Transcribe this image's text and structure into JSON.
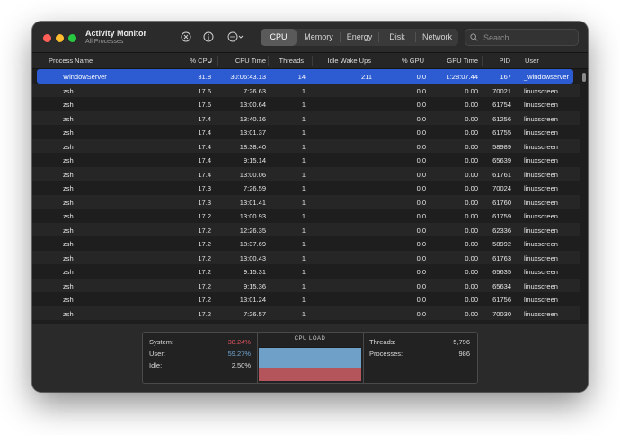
{
  "app": {
    "title": "Activity Monitor",
    "subtitle": "All Processes"
  },
  "toolbar": {
    "tabs": [
      {
        "label": "CPU",
        "active": true
      },
      {
        "label": "Memory",
        "active": false
      },
      {
        "label": "Energy",
        "active": false
      },
      {
        "label": "Disk",
        "active": false
      },
      {
        "label": "Network",
        "active": false
      }
    ],
    "search_placeholder": "Search"
  },
  "table": {
    "headers": {
      "name": "Process Name",
      "cpu": "% CPU",
      "cpu_time": "CPU Time",
      "threads": "Threads",
      "idle_wakeups": "Idle Wake Ups",
      "gpu": "% GPU",
      "gpu_time": "GPU Time",
      "pid": "PID",
      "user": "User"
    },
    "sort_indicator": "⌄",
    "rows": [
      {
        "name": "WindowServer",
        "cpu": "31.8",
        "cpu_time": "30:06:43.13",
        "threads": "14",
        "idle_wakeups": "211",
        "gpu": "0.0",
        "gpu_time": "1:28:07.44",
        "pid": "167",
        "user": "_windowserver",
        "selected": true
      },
      {
        "name": "zsh",
        "cpu": "17.6",
        "cpu_time": "7:26.63",
        "threads": "1",
        "idle_wakeups": "",
        "gpu": "0.0",
        "gpu_time": "0.00",
        "pid": "70021",
        "user": "linuxscreen"
      },
      {
        "name": "zsh",
        "cpu": "17.6",
        "cpu_time": "13:00.64",
        "threads": "1",
        "idle_wakeups": "",
        "gpu": "0.0",
        "gpu_time": "0.00",
        "pid": "61754",
        "user": "linuxscreen"
      },
      {
        "name": "zsh",
        "cpu": "17.4",
        "cpu_time": "13:40.16",
        "threads": "1",
        "idle_wakeups": "",
        "gpu": "0.0",
        "gpu_time": "0.00",
        "pid": "61256",
        "user": "linuxscreen"
      },
      {
        "name": "zsh",
        "cpu": "17.4",
        "cpu_time": "13:01.37",
        "threads": "1",
        "idle_wakeups": "",
        "gpu": "0.0",
        "gpu_time": "0.00",
        "pid": "61755",
        "user": "linuxscreen"
      },
      {
        "name": "zsh",
        "cpu": "17.4",
        "cpu_time": "18:38.40",
        "threads": "1",
        "idle_wakeups": "",
        "gpu": "0.0",
        "gpu_time": "0.00",
        "pid": "58989",
        "user": "linuxscreen"
      },
      {
        "name": "zsh",
        "cpu": "17.4",
        "cpu_time": "9:15.14",
        "threads": "1",
        "idle_wakeups": "",
        "gpu": "0.0",
        "gpu_time": "0.00",
        "pid": "65639",
        "user": "linuxscreen"
      },
      {
        "name": "zsh",
        "cpu": "17.4",
        "cpu_time": "13:00.06",
        "threads": "1",
        "idle_wakeups": "",
        "gpu": "0.0",
        "gpu_time": "0.00",
        "pid": "61761",
        "user": "linuxscreen"
      },
      {
        "name": "zsh",
        "cpu": "17.3",
        "cpu_time": "7:26.59",
        "threads": "1",
        "idle_wakeups": "",
        "gpu": "0.0",
        "gpu_time": "0.00",
        "pid": "70024",
        "user": "linuxscreen"
      },
      {
        "name": "zsh",
        "cpu": "17.3",
        "cpu_time": "13:01.41",
        "threads": "1",
        "idle_wakeups": "",
        "gpu": "0.0",
        "gpu_time": "0.00",
        "pid": "61760",
        "user": "linuxscreen"
      },
      {
        "name": "zsh",
        "cpu": "17.2",
        "cpu_time": "13:00.93",
        "threads": "1",
        "idle_wakeups": "",
        "gpu": "0.0",
        "gpu_time": "0.00",
        "pid": "61759",
        "user": "linuxscreen"
      },
      {
        "name": "zsh",
        "cpu": "17.2",
        "cpu_time": "12:26.35",
        "threads": "1",
        "idle_wakeups": "",
        "gpu": "0.0",
        "gpu_time": "0.00",
        "pid": "62336",
        "user": "linuxscreen"
      },
      {
        "name": "zsh",
        "cpu": "17.2",
        "cpu_time": "18:37.69",
        "threads": "1",
        "idle_wakeups": "",
        "gpu": "0.0",
        "gpu_time": "0.00",
        "pid": "58992",
        "user": "linuxscreen"
      },
      {
        "name": "zsh",
        "cpu": "17.2",
        "cpu_time": "13:00.43",
        "threads": "1",
        "idle_wakeups": "",
        "gpu": "0.0",
        "gpu_time": "0.00",
        "pid": "61763",
        "user": "linuxscreen"
      },
      {
        "name": "zsh",
        "cpu": "17.2",
        "cpu_time": "9:15.31",
        "threads": "1",
        "idle_wakeups": "",
        "gpu": "0.0",
        "gpu_time": "0.00",
        "pid": "65635",
        "user": "linuxscreen"
      },
      {
        "name": "zsh",
        "cpu": "17.2",
        "cpu_time": "9:15.36",
        "threads": "1",
        "idle_wakeups": "",
        "gpu": "0.0",
        "gpu_time": "0.00",
        "pid": "65634",
        "user": "linuxscreen"
      },
      {
        "name": "zsh",
        "cpu": "17.2",
        "cpu_time": "13:01.24",
        "threads": "1",
        "idle_wakeups": "",
        "gpu": "0.0",
        "gpu_time": "0.00",
        "pid": "61756",
        "user": "linuxscreen"
      },
      {
        "name": "zsh",
        "cpu": "17.2",
        "cpu_time": "7:26.57",
        "threads": "1",
        "idle_wakeups": "",
        "gpu": "0.0",
        "gpu_time": "0.00",
        "pid": "70030",
        "user": "linuxscreen"
      }
    ]
  },
  "summary": {
    "system_label": "System:",
    "system_value": "38.24%",
    "user_label": "User:",
    "user_value": "59.27%",
    "idle_label": "Idle:",
    "idle_value": "2.50%",
    "cpu_load_title": "CPU LOAD",
    "threads_label": "Threads:",
    "threads_value": "5,796",
    "processes_label": "Processes:",
    "processes_value": "986"
  },
  "colors": {
    "selection": "#2c5bd2",
    "system": "#e0555e",
    "user": "#6fa8d8",
    "close": "#ff5f57",
    "minimize": "#febc2e",
    "zoom": "#28c840"
  }
}
